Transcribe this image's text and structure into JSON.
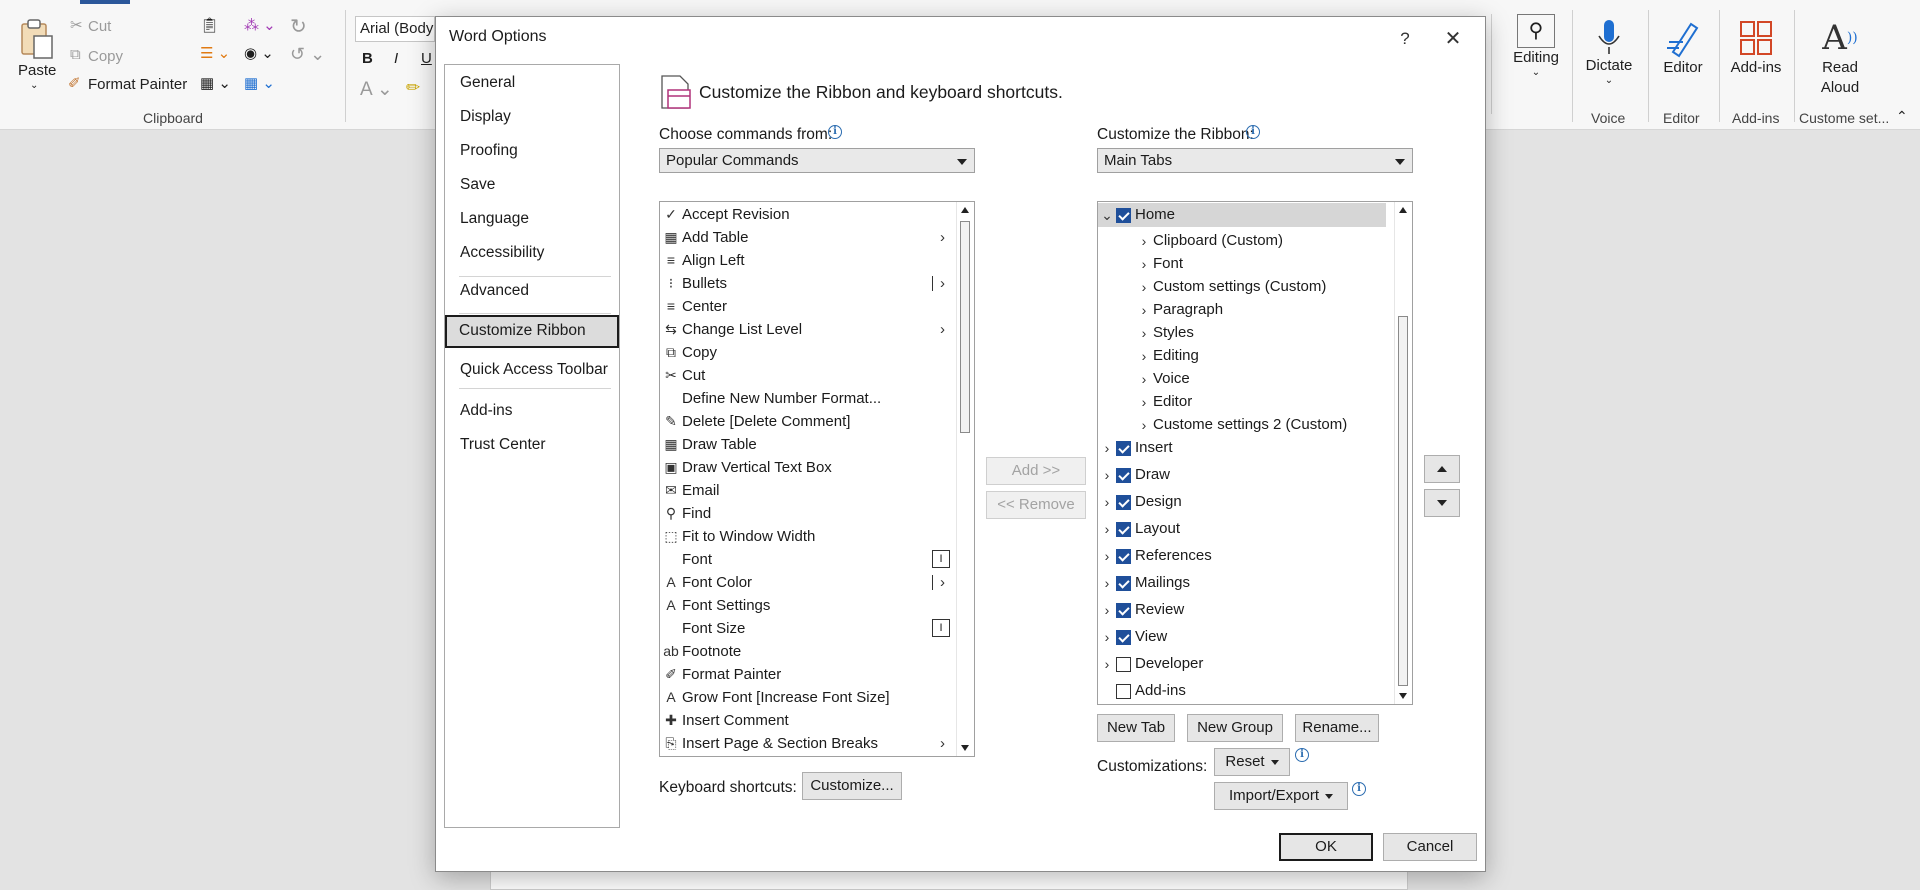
{
  "ribbon": {
    "paste": "Paste",
    "cut": "Cut",
    "copy": "Copy",
    "format_painter": "Format Painter",
    "clipboard_group": "Clipboard",
    "font_name": "Arial (Body",
    "bold": "B",
    "italic": "I",
    "underline": "U",
    "editing": "Editing",
    "dictate": "Dictate",
    "voice_group": "Voice",
    "editor": "Editor",
    "editor_group": "Editor",
    "addins": "Add-ins",
    "addins_group": "Add-ins",
    "read_aloud_line1": "Read",
    "read_aloud_line2": "Aloud",
    "custom_group": "Custome set..."
  },
  "dialog": {
    "title": "Word Options",
    "help": "?",
    "close": "✕",
    "nav": [
      "General",
      "Display",
      "Proofing",
      "Save",
      "Language",
      "Accessibility",
      "Advanced",
      "Customize Ribbon",
      "Quick Access Toolbar",
      "Add-ins",
      "Trust Center"
    ],
    "heading": "Customize the Ribbon and keyboard shortcuts.",
    "choose_label": "Choose commands from:",
    "choose_value": "Popular Commands",
    "ribbon_label": "Customize the Ribbon:",
    "ribbon_value": "Main Tabs",
    "commands": [
      {
        "text": "Accept Revision",
        "icon": "✓",
        "extra": ""
      },
      {
        "text": "Add Table",
        "icon": "▦",
        "extra": "chev"
      },
      {
        "text": "Align Left",
        "icon": "≡",
        "extra": ""
      },
      {
        "text": "Bullets",
        "icon": "⁝",
        "extra": "barchev"
      },
      {
        "text": "Center",
        "icon": "≡",
        "extra": ""
      },
      {
        "text": "Change List Level",
        "icon": "⇆",
        "extra": "chev"
      },
      {
        "text": "Copy",
        "icon": "⧉",
        "extra": ""
      },
      {
        "text": "Cut",
        "icon": "✂",
        "extra": ""
      },
      {
        "text": "Define New Number Format...",
        "icon": "",
        "extra": ""
      },
      {
        "text": "Delete [Delete Comment]",
        "icon": "✎",
        "extra": ""
      },
      {
        "text": "Draw Table",
        "icon": "▦",
        "extra": ""
      },
      {
        "text": "Draw Vertical Text Box",
        "icon": "▣",
        "extra": ""
      },
      {
        "text": "Email",
        "icon": "✉",
        "extra": ""
      },
      {
        "text": "Find",
        "icon": "⚲",
        "extra": ""
      },
      {
        "text": "Fit to Window Width",
        "icon": "⬚",
        "extra": ""
      },
      {
        "text": "Font",
        "icon": "",
        "extra": "box"
      },
      {
        "text": "Font Color",
        "icon": "A",
        "extra": "barchev"
      },
      {
        "text": "Font Settings",
        "icon": "A",
        "extra": ""
      },
      {
        "text": "Font Size",
        "icon": "",
        "extra": "box"
      },
      {
        "text": "Footnote",
        "icon": "ab",
        "extra": ""
      },
      {
        "text": "Format Painter",
        "icon": "✐",
        "extra": ""
      },
      {
        "text": "Grow Font [Increase Font Size]",
        "icon": "A",
        "extra": ""
      },
      {
        "text": "Insert Comment",
        "icon": "✚",
        "extra": ""
      },
      {
        "text": "Insert Page & Section Breaks",
        "icon": "⎘",
        "extra": "chev"
      }
    ],
    "add_button": "Add >>",
    "remove_button": "<< Remove",
    "tree": [
      {
        "text": "Home",
        "level": 0,
        "expanded": true,
        "checked": true,
        "selected": true
      },
      {
        "text": "Clipboard (Custom)",
        "level": 1
      },
      {
        "text": "Font",
        "level": 1
      },
      {
        "text": "Custom settings (Custom)",
        "level": 1
      },
      {
        "text": "Paragraph",
        "level": 1
      },
      {
        "text": "Styles",
        "level": 1
      },
      {
        "text": "Editing",
        "level": 1
      },
      {
        "text": "Voice",
        "level": 1
      },
      {
        "text": "Editor",
        "level": 1
      },
      {
        "text": "Custome settings 2 (Custom)",
        "level": 1
      },
      {
        "text": "Insert",
        "level": 0,
        "checked": true
      },
      {
        "text": "Draw",
        "level": 0,
        "checked": true
      },
      {
        "text": "Design",
        "level": 0,
        "checked": true
      },
      {
        "text": "Layout",
        "level": 0,
        "checked": true
      },
      {
        "text": "References",
        "level": 0,
        "checked": true
      },
      {
        "text": "Mailings",
        "level": 0,
        "checked": true
      },
      {
        "text": "Review",
        "level": 0,
        "checked": true
      },
      {
        "text": "View",
        "level": 0,
        "checked": true
      },
      {
        "text": "Developer",
        "level": 0,
        "checked": false
      },
      {
        "text": "Add-ins",
        "level": 0,
        "checked": false,
        "noexp": true
      }
    ],
    "new_tab": "New Tab",
    "new_group": "New Group",
    "rename": "Rename...",
    "customizations_label": "Customizations:",
    "reset": "Reset",
    "import_export": "Import/Export",
    "keyboard_label": "Keyboard shortcuts:",
    "customize_btn": "Customize...",
    "ok": "OK",
    "cancel": "Cancel"
  }
}
